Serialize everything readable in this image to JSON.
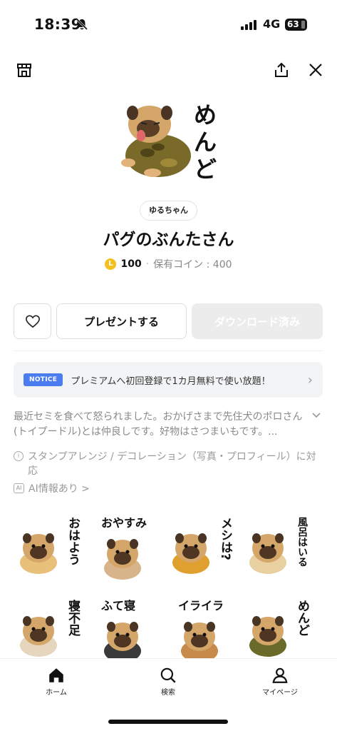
{
  "status_bar": {
    "time": "18:39",
    "network": "4G",
    "battery": "63"
  },
  "sticker_pack": {
    "hero_text": "めんど",
    "author": "ゆるちゃん",
    "title": "パグのぶんたさん",
    "coin_letter": "L",
    "price": "100",
    "separator": "·",
    "owned_coins": "保有コイン : 400"
  },
  "actions": {
    "present_label": "プレゼントする",
    "download_label": "ダウンロード済み"
  },
  "notice": {
    "badge": "NOTICE",
    "text": "プレミアムへ初回登録で1カ月無料で使い放題！",
    "chevron": "›"
  },
  "description": "最近セミを食べて怒られました。おかげさまで先住犬のポロさん(トイプードル)とは仲良しです。好物はさつまいもです。...",
  "info": {
    "arrange_icon": "i",
    "arrange_text": "スタンプアレンジ / デコレーション（写真・プロフィール）に対応",
    "ai_badge": "AI",
    "ai_text": "AI情報あり >"
  },
  "stickers": [
    {
      "text": "おはよう",
      "outfit": "#e8c07a"
    },
    {
      "text": "おやすみ",
      "outfit": "#d8b48a"
    },
    {
      "text": "メシは?",
      "outfit": "#e0a030"
    },
    {
      "text": "風呂はいる",
      "outfit": "#e8d0a0"
    },
    {
      "text": "寝不足",
      "outfit": "#e6d6be"
    },
    {
      "text": "ふて寝",
      "outfit": "#3a3a3a"
    },
    {
      "text": "イライラ",
      "outfit": "#c88a4a"
    },
    {
      "text": "めんど",
      "outfit": "#6a6a2a"
    }
  ],
  "nav": {
    "home": "ホーム",
    "search": "検索",
    "mypage": "マイページ"
  },
  "colors": {
    "accent_blue": "#4b7df0",
    "coin": "#f4c020"
  }
}
